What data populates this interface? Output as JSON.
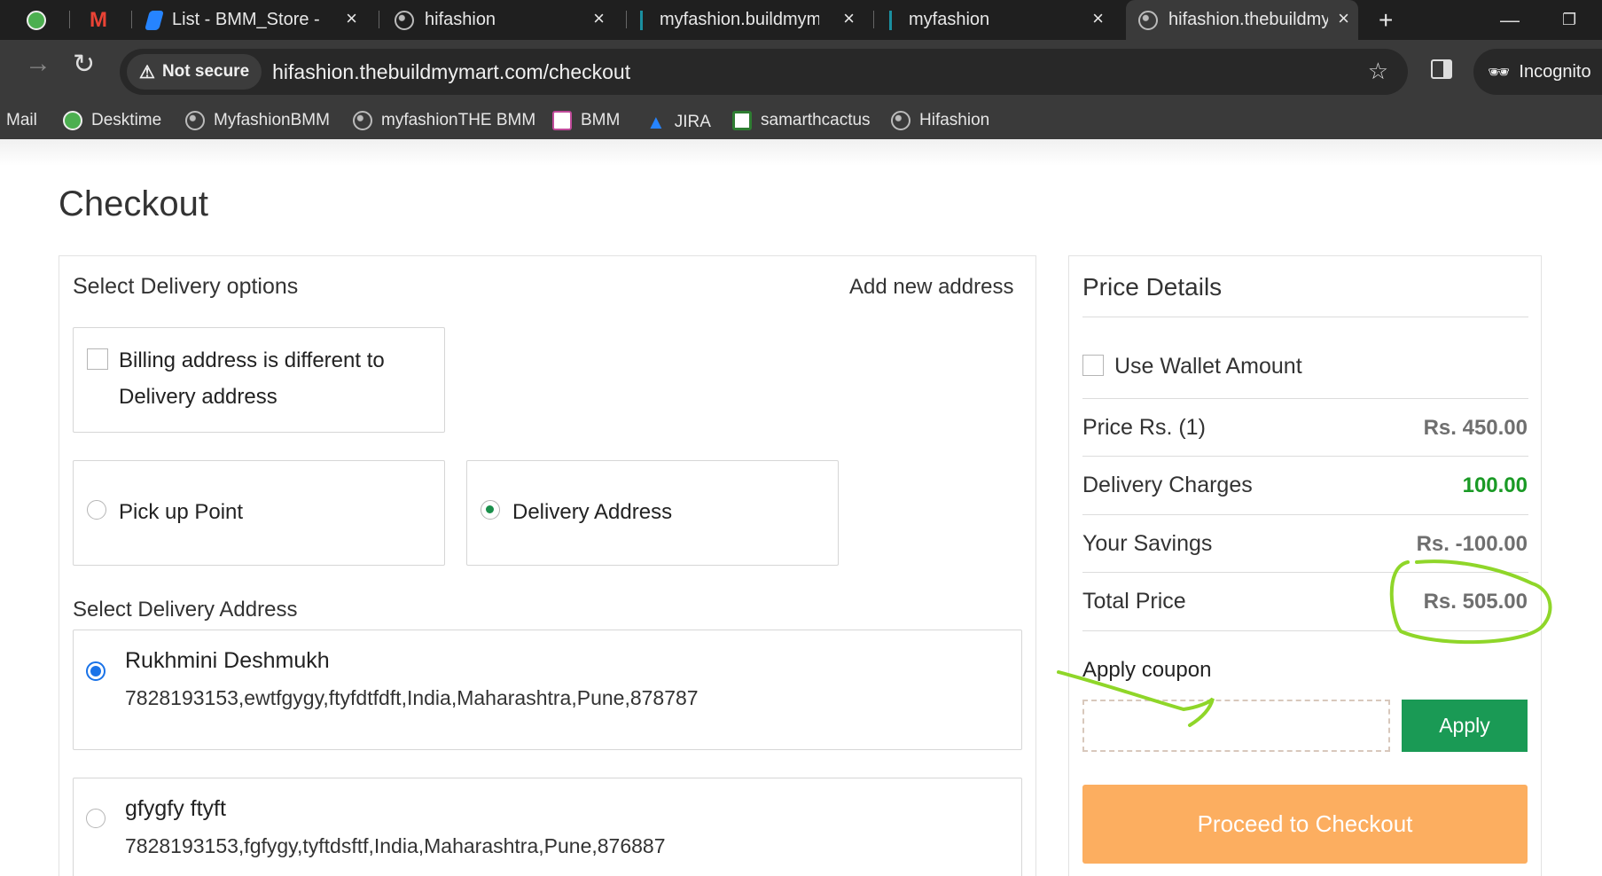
{
  "browser": {
    "tabs": [
      {
        "title": ""
      },
      {
        "title": ""
      },
      {
        "title": "List - BMM_Store - Jira"
      },
      {
        "title": "hifashion"
      },
      {
        "title": "myfashion.buildmymart"
      },
      {
        "title": "myfashion"
      },
      {
        "title": "hifashion.thebuildmymart"
      }
    ],
    "new_tab": "+",
    "security_label": "Not secure",
    "url": "hifashion.thebuildmymart.com/checkout",
    "profile_label": "Incognito",
    "bookmarks": [
      "Mail",
      "Desktime",
      "MyfashionBMM",
      "myfashionTHE BMM",
      "BMM",
      "JIRA",
      "samarthcactus",
      "Hifashion"
    ]
  },
  "page": {
    "title": "Checkout",
    "delivery": {
      "section_title": "Select Delivery options",
      "add_new_address": "Add new address",
      "billing_line1": "Billing address is different to",
      "billing_line2": "Delivery address",
      "pickup_label": "Pick up Point",
      "delivery_label": "Delivery Address",
      "address_section_title": "Select Delivery Address",
      "addresses": [
        {
          "name": "Rukhmini Deshmukh",
          "details": "7828193153,ewtfgygy,ftyfdtfdft,India,Maharashtra,Pune,878787"
        },
        {
          "name": "gfygfy ftyft",
          "details": "7828193153,fgfygy,tyftdsftf,India,Maharashtra,Pune,876887"
        }
      ]
    },
    "price": {
      "title": "Price Details",
      "use_wallet": "Use Wallet Amount",
      "rows": [
        {
          "label": "Price Rs. (1)",
          "value": "Rs. 450.00"
        },
        {
          "label": "Delivery Charges",
          "value": "100.00"
        },
        {
          "label": "Your Savings",
          "value": "Rs. -100.00"
        },
        {
          "label": "Total Price",
          "value": "Rs. 505.00"
        }
      ],
      "coupon_label": "Apply coupon",
      "coupon_value": "",
      "apply_label": "Apply",
      "checkout_label": "Proceed to Checkout"
    }
  },
  "colors": {
    "accent_green": "#1a9a55",
    "checkout_orange": "#fcae60",
    "annotation": "#8fd629"
  }
}
